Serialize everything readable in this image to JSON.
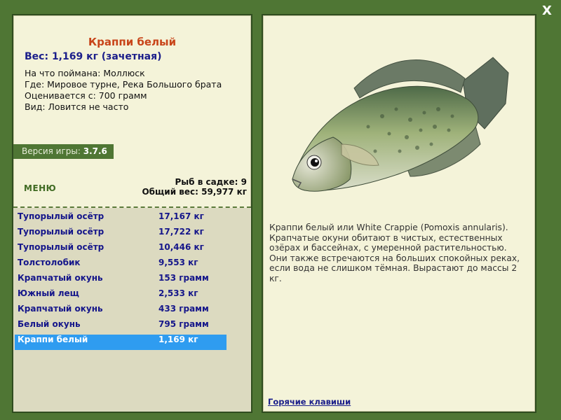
{
  "window": {
    "close_label": "X"
  },
  "fish": {
    "title": "Краппи белый",
    "weight": "Вес: 1,169 кг (зачетная)",
    "bait": "На что поймана: Моллюск",
    "location": "Где: Мировое турне, Река Большого брата",
    "value": "Оценивается с: 700 грамм",
    "rarity": "Вид: Ловится не часто",
    "description": "Краппи белый или White Crappie (Pomoxis annularis). Крапчатые окуни обитают в чистых, естественных озёрах и бассейнах, с умеренной растительностью. Они также встречаются на больших спокойных реках, если вода не слишком тёмная. Вырастают до массы 2 кг."
  },
  "version": {
    "label": "Версия игры:",
    "value": "3.7.6"
  },
  "menu_label": "МЕНЮ",
  "stats": {
    "fish_count": "Рыб в садке: 9",
    "total_weight": "Общий вес: 59,977 кг"
  },
  "catch_list": [
    {
      "name": "Тупорылый осётр",
      "weight": "17,167 кг"
    },
    {
      "name": "Тупорылый осётр",
      "weight": "17,722 кг"
    },
    {
      "name": "Тупорылый осётр",
      "weight": "10,446 кг"
    },
    {
      "name": "Толстолобик",
      "weight": "9,553 кг"
    },
    {
      "name": "Крапчатый окунь",
      "weight": "153 грамм"
    },
    {
      "name": "Южный лещ",
      "weight": "2,533 кг"
    },
    {
      "name": "Крапчатый окунь",
      "weight": "433 грамм"
    },
    {
      "name": "Белый окунь",
      "weight": "795 грамм"
    },
    {
      "name": "Краппи белый",
      "weight": "1,169 кг"
    }
  ],
  "selected_index": 8,
  "hotkeys_label": "Горячие клавиши",
  "colors": {
    "background": "#4f7634",
    "panel": "#f4f3d9",
    "title": "#c8451a",
    "link": "#1b1e8a",
    "selection": "#2f9cf0"
  }
}
